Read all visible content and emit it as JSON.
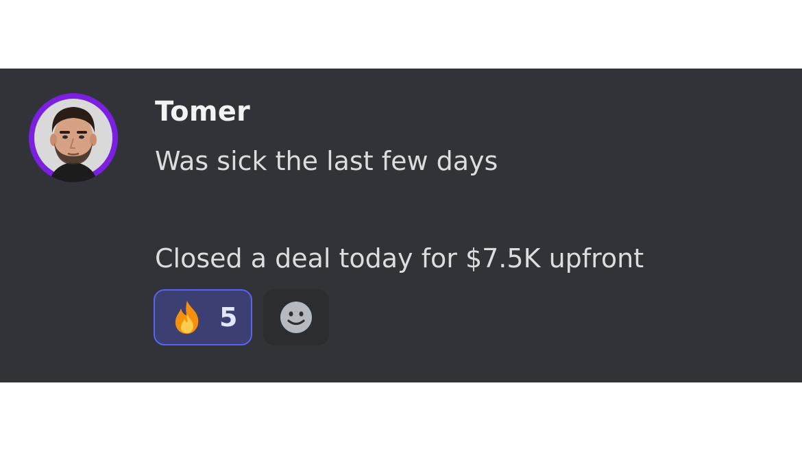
{
  "message": {
    "author": "Tomer",
    "lines": [
      "Was sick the last few days",
      "",
      "Closed a deal today for $7.5K upfront"
    ],
    "avatar_ring_color": "#7b1fe0"
  },
  "reactions": [
    {
      "emoji": "fire-icon",
      "count": "5",
      "selected": true
    }
  ],
  "add_reaction_icon": "smiley-face-icon"
}
